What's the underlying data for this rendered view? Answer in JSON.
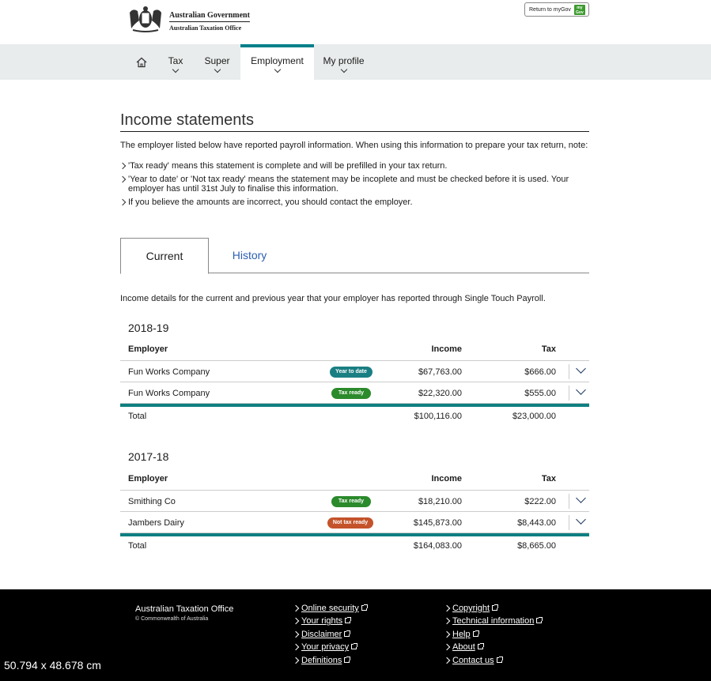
{
  "header": {
    "gov_line1": "Australian Government",
    "gov_line2": "Australian Taxation Office",
    "mygov_button": "Return to myGov",
    "mygov_badge": "my Gov"
  },
  "nav": {
    "home_icon": "home-icon",
    "items": [
      {
        "label": "Tax",
        "active": false
      },
      {
        "label": "Super",
        "active": false
      },
      {
        "label": "Employment",
        "active": true
      },
      {
        "label": "My profile",
        "active": false
      }
    ]
  },
  "page": {
    "title": "Income statements",
    "intro": "The employer listed below have reported payroll information. When using this information to prepare your tax return, note:",
    "notes": [
      "'Tax ready' means this statement is complete and will be prefilled in your tax return.",
      "'Year to date' or 'Not tax ready' means the statement may be incoplete and must be checked before it is used. Your employer has until 31st July to finalise this information.",
      "If you believe the amounts are incorrect, you should contact the employer."
    ]
  },
  "tabs": [
    {
      "label": "Current",
      "active": true
    },
    {
      "label": "History",
      "active": false
    }
  ],
  "tab_desc": "Income details for the current and previous year that your employer has reported through Single Touch Payroll.",
  "columns": {
    "employer": "Employer",
    "income": "Income",
    "tax": "Tax"
  },
  "total_label": "Total",
  "colors": {
    "teal": "#0e7f81",
    "year_to_date": "#1a7f83",
    "tax_ready": "#2b8a2b",
    "not_tax_ready": "#c4532b",
    "history_link": "#2b5fb3"
  },
  "years": [
    {
      "year": "2018-19",
      "rows": [
        {
          "employer": "Fun Works Company",
          "status": "Year to date",
          "status_kind": "year_to_date",
          "income": "$67,763.00",
          "tax": "$666.00"
        },
        {
          "employer": "Fun Works Company",
          "status": "Tax ready",
          "status_kind": "tax_ready",
          "income": "$22,320.00",
          "tax": "$555.00"
        }
      ],
      "total_income": "$100,116.00",
      "total_tax": "$23,000.00"
    },
    {
      "year": "2017-18",
      "rows": [
        {
          "employer": "Smithing Co",
          "status": "Tax ready",
          "status_kind": "tax_ready",
          "income": "$18,210.00",
          "tax": "$222.00"
        },
        {
          "employer": "Jambers Dairy",
          "status": "Not tax ready",
          "status_kind": "not_tax_ready",
          "income": "$145,873.00",
          "tax": "$8,443.00"
        }
      ],
      "total_income": "$164,083.00",
      "total_tax": "$8,665.00"
    }
  ],
  "footer": {
    "org": "Australian Taxation Office",
    "copyright": "© Commonwealth of Australia",
    "links_col1": [
      "Online security",
      "Your rights",
      "Disclaimer",
      "Your privacy",
      "Definitions"
    ],
    "links_col2": [
      "Copyright",
      "Technical information",
      "Help",
      "About",
      "Contact us"
    ]
  },
  "overlay_text": "50.794 x 48.678 cm"
}
